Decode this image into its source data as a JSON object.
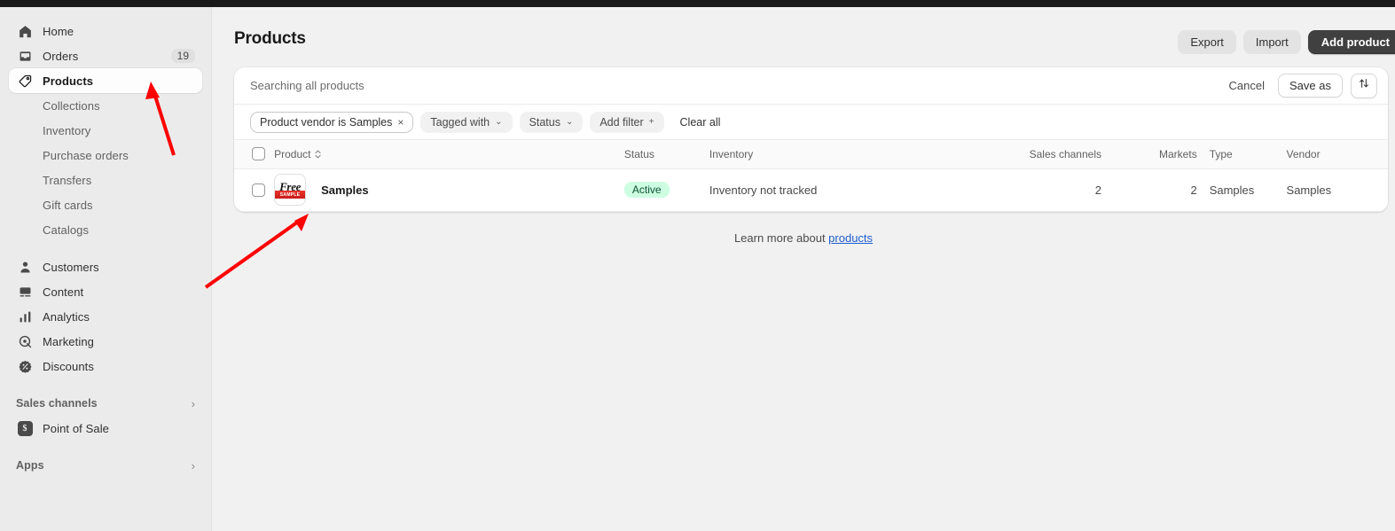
{
  "sidebar": {
    "primary": [
      {
        "label": "Home",
        "icon": "home-icon",
        "badge": "",
        "active": false
      },
      {
        "label": "Orders",
        "icon": "orders-inbox-icon",
        "badge": "19",
        "active": false
      },
      {
        "label": "Products",
        "icon": "product-tag-icon",
        "badge": "",
        "active": true
      }
    ],
    "product_subitems": [
      {
        "label": "Collections"
      },
      {
        "label": "Inventory"
      },
      {
        "label": "Purchase orders"
      },
      {
        "label": "Transfers"
      },
      {
        "label": "Gift cards"
      },
      {
        "label": "Catalogs"
      }
    ],
    "secondary": [
      {
        "label": "Customers",
        "icon": "customer-person-icon"
      },
      {
        "label": "Content",
        "icon": "content-media-icon"
      },
      {
        "label": "Analytics",
        "icon": "analytics-bars-icon"
      },
      {
        "label": "Marketing",
        "icon": "marketing-target-icon"
      },
      {
        "label": "Discounts",
        "icon": "discount-badge-icon"
      }
    ],
    "sales_channels": {
      "label": "Sales channels",
      "chevron": "›"
    },
    "point_of_sale": {
      "label": "Point of Sale",
      "icon": "point-of-sale-icon",
      "glyph": "$"
    },
    "apps": {
      "label": "Apps",
      "chevron": "›"
    }
  },
  "header": {
    "title": "Products",
    "export_label": "Export",
    "import_label": "Import",
    "add_product_label": "Add product"
  },
  "search": {
    "placeholder": "Searching all products",
    "cancel_label": "Cancel",
    "save_as_label": "Save as",
    "sort_icon": "sort-arrows-icon"
  },
  "filters": {
    "applied": {
      "label": "Product vendor is Samples",
      "remove": "×"
    },
    "chips": [
      {
        "label": "Tagged with",
        "caret": "⌄"
      },
      {
        "label": "Status",
        "caret": "⌄"
      },
      {
        "label": "Add filter",
        "caret": "+"
      }
    ],
    "clear_all_label": "Clear all"
  },
  "table": {
    "columns": [
      {
        "key": "product",
        "label": "Product",
        "sortable": true
      },
      {
        "key": "status",
        "label": "Status",
        "sortable": false
      },
      {
        "key": "inventory",
        "label": "Inventory",
        "sortable": false
      },
      {
        "key": "sales_channels",
        "label": "Sales channels",
        "sortable": false
      },
      {
        "key": "markets",
        "label": "Markets",
        "sortable": false
      },
      {
        "key": "type",
        "label": "Type",
        "sortable": false
      },
      {
        "key": "vendor",
        "label": "Vendor",
        "sortable": false
      }
    ],
    "rows": [
      {
        "product": "Samples",
        "thumbnail": {
          "word": "Free",
          "banner": "SAMPLE"
        },
        "status": "Active",
        "inventory": "Inventory not tracked",
        "sales_channels": "2",
        "markets": "2",
        "type": "Samples",
        "vendor": "Samples"
      }
    ]
  },
  "footer": {
    "text": "Learn more about ",
    "link_label": "products"
  },
  "colors": {
    "accent_dark": "#404040",
    "badge_bg": "#cdfee1",
    "badge_text": "#0c5132",
    "link": "#1d5fce",
    "annotation": "#ff0000",
    "sidebar_bg": "#ebebeb",
    "page_bg": "#f1f1f1"
  },
  "annotations": [
    {
      "name": "arrow-to-products-nav",
      "color": "#ff0000"
    },
    {
      "name": "arrow-to-product-thumbnail",
      "color": "#ff0000"
    }
  ]
}
